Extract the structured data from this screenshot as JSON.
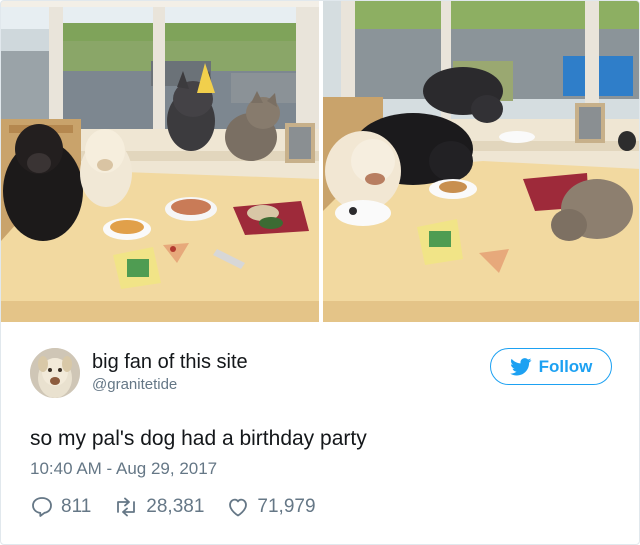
{
  "tweet": {
    "author": {
      "display_name": "big fan of this site",
      "handle": "@granitetide"
    },
    "follow_label": "Follow",
    "text": "so my pal's dog had a birthday party",
    "timestamp": "10:40 AM - Aug 29, 2017",
    "stats": {
      "replies": "811",
      "retweets": "28,381",
      "likes": "71,979"
    }
  },
  "colors": {
    "accent": "#1da1f2",
    "muted": "#657786",
    "text": "#14171a",
    "border": "#e1e8ed"
  },
  "icons": [
    "twitter-bird-icon",
    "reply-icon",
    "retweet-icon",
    "heart-icon"
  ]
}
